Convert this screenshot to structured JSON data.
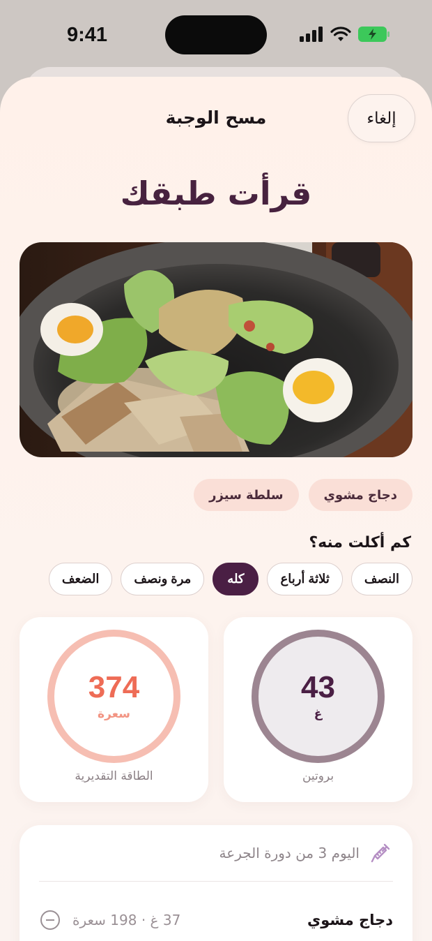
{
  "status_bar": {
    "time": "9:41"
  },
  "header": {
    "title": "مسح الوجبة",
    "cancel_label": "إلغاء"
  },
  "headline": "قرأت طبقك",
  "photo": {
    "description_icon": "meal-photo"
  },
  "detected_items": [
    "دجاج مشوي",
    "سلطة سيزر"
  ],
  "portion": {
    "question": "كم أكلت منه؟",
    "options": [
      "النصف",
      "ثلاثة أرباع",
      "كله",
      "مرة ونصف",
      "الضعف"
    ],
    "selected": "كله"
  },
  "nutrition": {
    "protein": {
      "value": "43",
      "unit": "غ",
      "label": "بروتين"
    },
    "energy": {
      "value": "374",
      "unit": "سعرة",
      "label": "الطاقة التقديرية"
    }
  },
  "cycle": {
    "text": "اليوم 3 من دورة الجرعة",
    "icon": "syringe-icon"
  },
  "food_items": [
    {
      "name": "دجاج مشوي",
      "macros": "37 غ · 198 سعرة"
    }
  ],
  "colors": {
    "accent": "#4a1f44",
    "energy": "#ee6c56",
    "chip_bg": "#fadfd7"
  }
}
